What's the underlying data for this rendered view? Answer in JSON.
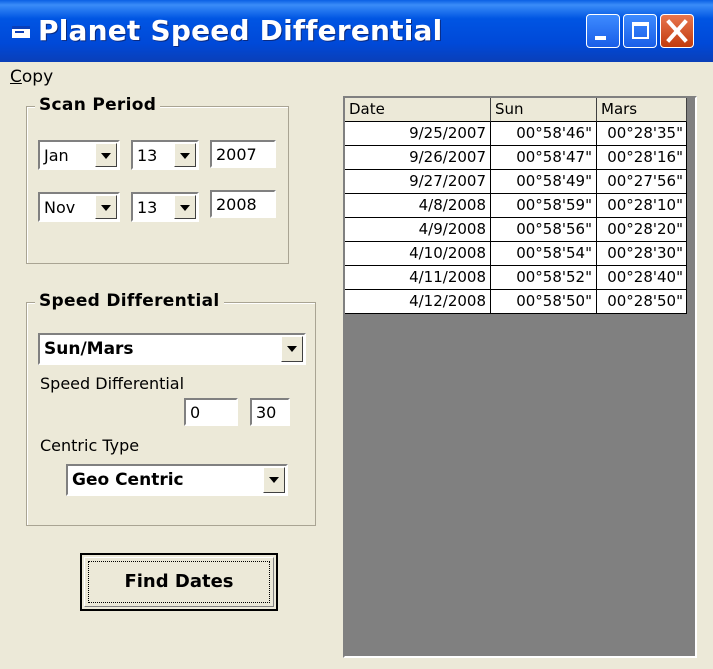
{
  "window": {
    "title": "Planet Speed Differential"
  },
  "menu": {
    "copy_underlined": "C",
    "copy_rest": "opy"
  },
  "scan_period": {
    "legend": "Scan Period",
    "start": {
      "month": "Jan",
      "day": "13",
      "year": "2007"
    },
    "end": {
      "month": "Nov",
      "day": "13",
      "year": "2008"
    }
  },
  "speed_differential": {
    "legend": "Speed Differential",
    "planet_pair": "Sun/Mars",
    "label": "Speed Differential",
    "value_a": "0",
    "value_b": "30",
    "centric_label": "Centric Type",
    "centric_value": "Geo Centric"
  },
  "find_button": {
    "label": "Find Dates"
  },
  "results": {
    "columns": [
      "Date",
      "Sun",
      "Mars"
    ],
    "rows": [
      [
        "9/25/2007",
        "00°58'46\"",
        "00°28'35\""
      ],
      [
        "9/26/2007",
        "00°58'47\"",
        "00°28'16\""
      ],
      [
        "9/27/2007",
        "00°58'49\"",
        "00°27'56\""
      ],
      [
        "4/8/2008",
        "00°58'59\"",
        "00°28'10\""
      ],
      [
        "4/9/2008",
        "00°58'56\"",
        "00°28'20\""
      ],
      [
        "4/10/2008",
        "00°58'54\"",
        "00°28'30\""
      ],
      [
        "4/11/2008",
        "00°58'52\"",
        "00°28'40\""
      ],
      [
        "4/12/2008",
        "00°58'50\"",
        "00°28'50\""
      ]
    ]
  }
}
